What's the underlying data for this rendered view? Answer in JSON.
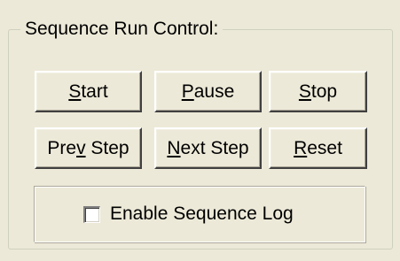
{
  "group": {
    "title": "Sequence Run Control:"
  },
  "buttons": {
    "start": {
      "pre": "",
      "mnemonic": "S",
      "post": "tart"
    },
    "pause": {
      "pre": "",
      "mnemonic": "P",
      "post": "ause"
    },
    "stop": {
      "pre": "",
      "mnemonic": "S",
      "post": "top"
    },
    "prev_step": {
      "pre": "Pre",
      "mnemonic": "v",
      "post": " Step"
    },
    "next_step": {
      "pre": "",
      "mnemonic": "N",
      "post": "ext Step"
    },
    "reset": {
      "pre": "",
      "mnemonic": "R",
      "post": "eset"
    }
  },
  "log": {
    "label": "Enable Sequence Log",
    "checked": false
  }
}
